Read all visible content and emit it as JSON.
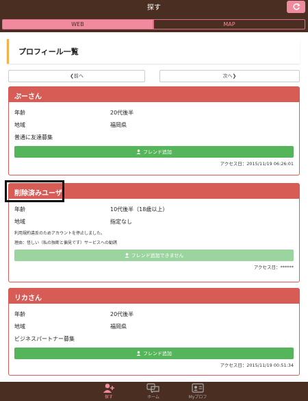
{
  "topbar": {
    "title": "探す",
    "refresh_icon": "refresh-icon"
  },
  "segments": {
    "web": "WEB",
    "map": "MAP"
  },
  "header": {
    "title": "プロフィール一覧"
  },
  "pager": {
    "prev": "❮前へ",
    "next": "次へ❯"
  },
  "cards": [
    {
      "name": "ぷーさん",
      "age_label": "年齢",
      "age": "20代後半",
      "region_label": "地域",
      "region": "福岡県",
      "note": "普通に友達募集",
      "button": "フレンド追加",
      "access": "アクセス日：2015/11/19 06:26:01"
    },
    {
      "name": "削除済みユーザ",
      "age_label": "年齢",
      "age": "10代後半（18歳以上）",
      "region_label": "地域",
      "region": "指定なし",
      "note1": "利用規約違反のためアカウントを停止しました。",
      "note2": "理由：怪しい（私の独断と偏見です）サービスへの勧誘",
      "button": "フレンド追加できません",
      "access": "アクセス日：******"
    },
    {
      "name": "リカさん",
      "age_label": "年齢",
      "age": "20代後半",
      "region_label": "地域",
      "region": "福岡県",
      "note": "ビジネスパートナー募集",
      "button": "フレンド追加",
      "access": "アクセス日：2015/11/19 00:51:34"
    }
  ],
  "tabs": [
    {
      "label": "探す",
      "icon": "add-user-icon"
    },
    {
      "label": "ホーム",
      "icon": "chat-icon"
    },
    {
      "label": "Myプロフ",
      "icon": "profile-card-icon"
    }
  ],
  "colors": {
    "brown": "#4a2e22",
    "pink": "#f08a9e",
    "red": "#d75c56",
    "green": "#55b55a",
    "yellow": "#f5b04b"
  }
}
